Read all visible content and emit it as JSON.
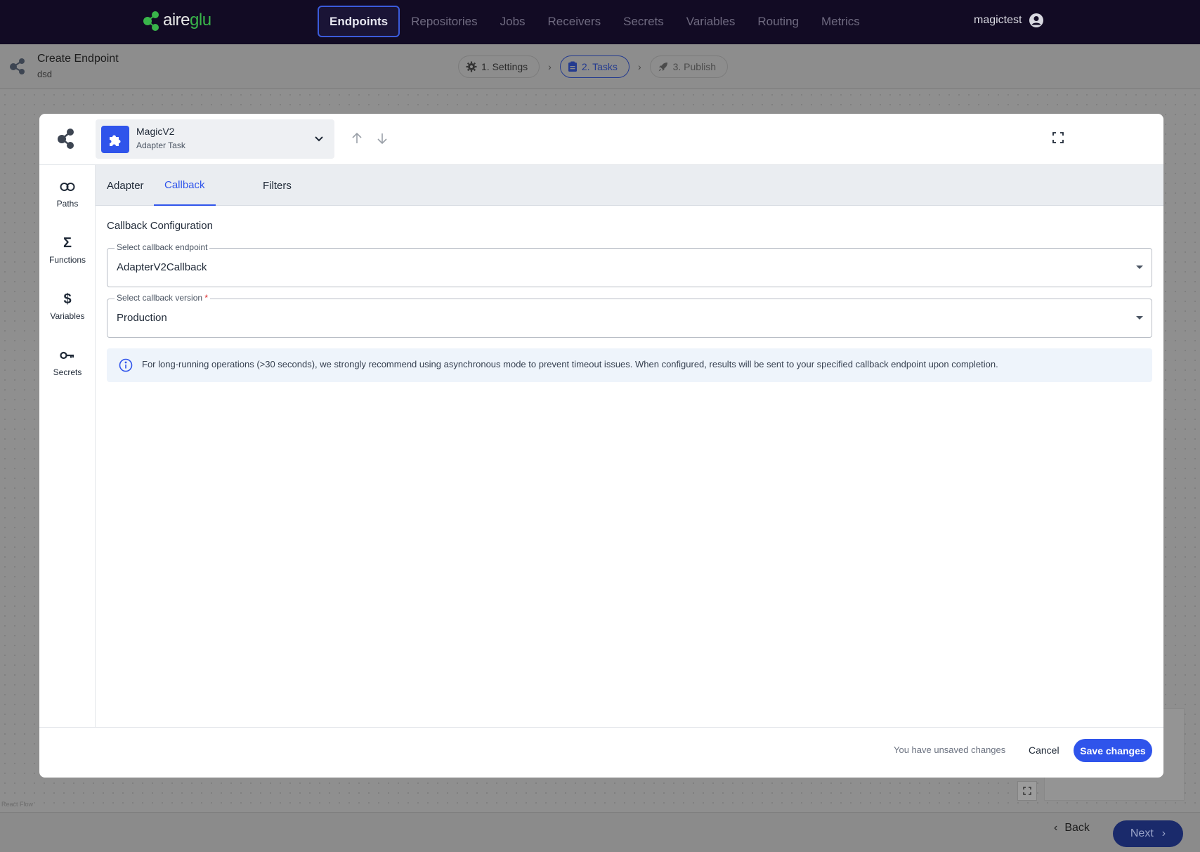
{
  "brand": {
    "part1": "aire",
    "part2": "glu"
  },
  "nav": {
    "items": [
      {
        "label": "Endpoints",
        "active": true
      },
      {
        "label": "Repositories"
      },
      {
        "label": "Jobs"
      },
      {
        "label": "Receivers"
      },
      {
        "label": "Secrets"
      },
      {
        "label": "Variables"
      },
      {
        "label": "Routing"
      },
      {
        "label": "Metrics"
      }
    ],
    "user": "magictest"
  },
  "subheader": {
    "title": "Create Endpoint",
    "subtitle": "dsd",
    "steps": [
      {
        "label": "1. Settings",
        "icon": "gear-icon"
      },
      {
        "label": "2. Tasks",
        "icon": "clipboard-icon",
        "active": true
      },
      {
        "label": "3. Publish",
        "icon": "rocket-icon"
      }
    ]
  },
  "modal": {
    "task": {
      "name": "MagicV2",
      "type": "Adapter Task"
    },
    "sidebar": [
      {
        "label": "Paths",
        "icon": "link-icon"
      },
      {
        "label": "Functions",
        "icon": "sigma-icon"
      },
      {
        "label": "Variables",
        "icon": "dollar-icon"
      },
      {
        "label": "Secrets",
        "icon": "key-icon"
      }
    ],
    "tabs": [
      {
        "label": "Adapter"
      },
      {
        "label": "Callback",
        "active": true
      },
      {
        "label": "Filters"
      }
    ],
    "section_title": "Callback Configuration",
    "callback_endpoint": {
      "label": "Select callback endpoint",
      "value": "AdapterV2Callback"
    },
    "callback_version": {
      "label": "Select callback version",
      "required_mark": "*",
      "value": "Production"
    },
    "info": "For long-running operations (>30 seconds), we strongly recommend using asynchronous mode to prevent timeout issues. When configured, results will be sent to your specified callback endpoint upon completion.",
    "footer": {
      "unsaved": "You have unsaved changes",
      "cancel": "Cancel",
      "save": "Save changes"
    }
  },
  "canvas": {
    "attribution": "React Flow"
  },
  "footer": {
    "back": "Back",
    "next": "Next"
  },
  "colors": {
    "accent": "#2f54eb",
    "nav_bg": "#120b24",
    "brand_green": "#39b54a"
  }
}
